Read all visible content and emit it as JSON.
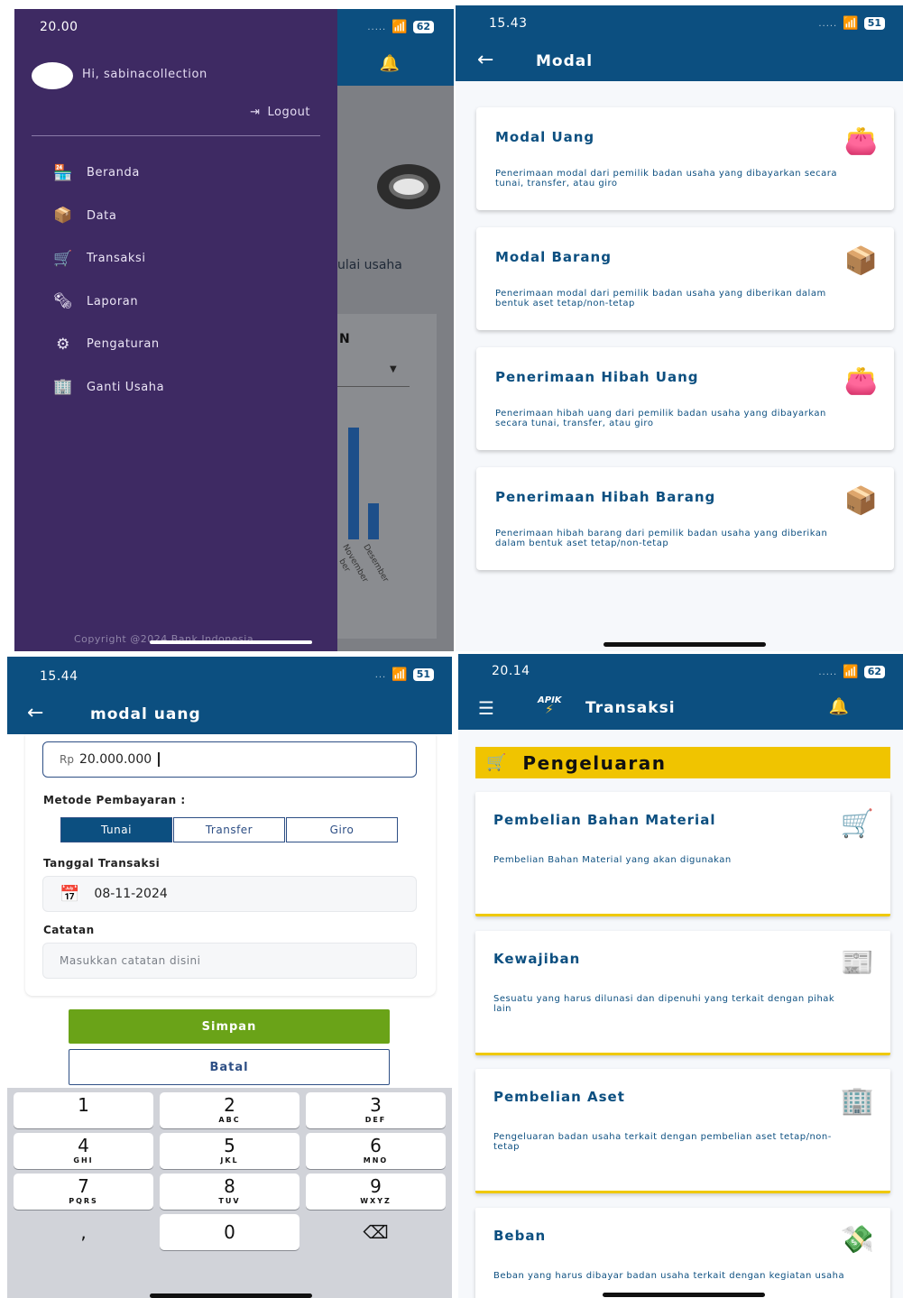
{
  "panel1": {
    "time": "20.00",
    "battery": "62",
    "greeting": "Hi, sabinacollection",
    "logout": "Logout",
    "menu": [
      {
        "label": "Beranda",
        "icon": "store-icon"
      },
      {
        "label": "Data",
        "icon": "boxes-icon"
      },
      {
        "label": "Transaksi",
        "icon": "cart-icon"
      },
      {
        "label": "Laporan",
        "icon": "report-icon"
      },
      {
        "label": "Pengaturan",
        "icon": "gears-icon"
      },
      {
        "label": "Ganti Usaha",
        "icon": "building-icon"
      }
    ],
    "background_text": "ulai usaha",
    "background_letter": "N",
    "chart_labels": [
      "ber",
      "November",
      "Desember"
    ],
    "copyright": "Copyright @2024 Bank Indonesia"
  },
  "panel2": {
    "time": "15.43",
    "battery": "51",
    "title": "Modal",
    "cards": [
      {
        "title": "Modal Uang",
        "desc": "Penerimaan modal dari pemilik badan usaha yang dibayarkan secara tunai, transfer, atau giro",
        "icon": "wallet-icon"
      },
      {
        "title": "Modal Barang",
        "desc": "Penerimaan modal dari pemilik badan usaha yang diberikan dalam bentuk aset tetap/non-tetap",
        "icon": "boxes-icon"
      },
      {
        "title": "Penerimaan Hibah Uang",
        "desc": "Penerimaan hibah uang dari pemilik badan usaha yang dibayarkan secara tunai, transfer, atau giro",
        "icon": "wallet-icon"
      },
      {
        "title": "Penerimaan Hibah Barang",
        "desc": "Penerimaan hibah barang dari pemilik badan usaha yang diberikan dalam bentuk aset tetap/non-tetap",
        "icon": "boxes-icon"
      }
    ]
  },
  "panel3": {
    "time": "15.44",
    "battery": "51",
    "title": "modal uang",
    "amount_prefix": "Rp",
    "amount_value": "20.000.000",
    "payment_label": "Metode Pembayaran :",
    "payment_options": [
      "Tunai",
      "Transfer",
      "Giro"
    ],
    "payment_selected": "Tunai",
    "date_label": "Tanggal Transaksi",
    "date_value": "08-11-2024",
    "note_label": "Catatan",
    "note_placeholder": "Masukkan catatan disini",
    "save": "Simpan",
    "cancel": "Batal",
    "keys": [
      {
        "num": "1",
        "sub": ""
      },
      {
        "num": "2",
        "sub": "ABC"
      },
      {
        "num": "3",
        "sub": "DEF"
      },
      {
        "num": "4",
        "sub": "GHI"
      },
      {
        "num": "5",
        "sub": "JKL"
      },
      {
        "num": "6",
        "sub": "MNO"
      },
      {
        "num": "7",
        "sub": "PQRS"
      },
      {
        "num": "8",
        "sub": "TUV"
      },
      {
        "num": "9",
        "sub": "WXYZ"
      },
      {
        "num": ",",
        "sub": ""
      },
      {
        "num": "0",
        "sub": ""
      },
      {
        "num": "⌫",
        "sub": ""
      }
    ]
  },
  "panel4": {
    "time": "20.14",
    "battery": "62",
    "logo": "APIK",
    "title": "Transaksi",
    "section": "Pengeluaran",
    "cards": [
      {
        "title": "Pembelian Bahan Material",
        "desc": "Pembelian Bahan Material yang akan digunakan",
        "icon": "cart-icon"
      },
      {
        "title": "Kewajiban",
        "desc": "Sesuatu yang harus dilunasi dan dipenuhi yang terkait dengan pihak lain",
        "icon": "ledger-icon"
      },
      {
        "title": "Pembelian Aset",
        "desc": "Pengeluaran badan usaha terkait dengan pembelian aset tetap/non-tetap",
        "icon": "building-icon"
      },
      {
        "title": "Beban",
        "desc": "Beban yang harus dibayar badan usaha terkait dengan kegiatan usaha",
        "icon": "money-icon"
      }
    ]
  }
}
